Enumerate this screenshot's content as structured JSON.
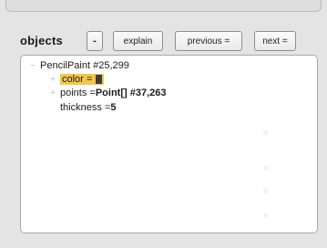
{
  "toolbar": {
    "title": "objects",
    "minus_label": "-",
    "explain_label": "explain",
    "previous_label": "previous =",
    "next_label": "next ="
  },
  "tree": {
    "root": {
      "toggle": "−",
      "label": "PencilPaint #25,299"
    },
    "color": {
      "toggle": "+",
      "label": "color = "
    },
    "points": {
      "toggle": "+",
      "label": "points = ",
      "value": "Point[] #37,263"
    },
    "thickness": {
      "label": "thickness = ",
      "value": "5"
    }
  },
  "colors": {
    "selection": "#f4c64a",
    "color_value_swatch": "#3d3d3d"
  }
}
